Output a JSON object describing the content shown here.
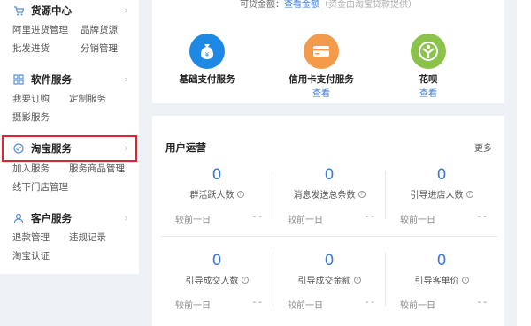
{
  "sidebar": {
    "sections": [
      {
        "title": "货源中心",
        "icon": "cart-icon",
        "links": [
          [
            "阿里进货管理",
            "品牌货源"
          ],
          [
            "批发进货",
            "分销管理"
          ]
        ]
      },
      {
        "title": "软件服务",
        "icon": "grid-icon",
        "links": [
          [
            "我要订购",
            "定制服务"
          ],
          [
            "摄影服务"
          ]
        ]
      },
      {
        "title": "淘宝服务",
        "icon": "taobao-icon",
        "links": [
          [
            "加入服务",
            "服务商品管理"
          ],
          [
            "线下门店管理"
          ]
        ]
      },
      {
        "title": "客户服务",
        "icon": "user-icon",
        "links": [
          [
            "退款管理",
            "违规记录"
          ],
          [
            "淘宝认证"
          ]
        ]
      }
    ]
  },
  "credit": {
    "prefix": "可贷金额：",
    "link": "查看金额",
    "note": "（资金由淘宝贷款提供）"
  },
  "services": [
    {
      "name": "基础支付服务",
      "view": "",
      "color": "#1e88e5",
      "icon": "money-bag-icon"
    },
    {
      "name": "信用卡支付服务",
      "view": "查看",
      "color": "#f39a4b",
      "icon": "credit-card-icon"
    },
    {
      "name": "花呗",
      "view": "查看",
      "color": "#8bc34a",
      "icon": "huabei-icon"
    }
  ],
  "ops": {
    "title": "用户运营",
    "more": "更多",
    "compare_label": "较前一日",
    "compare_value": "- -",
    "metrics": [
      {
        "value": "0",
        "label": "群活跃人数"
      },
      {
        "value": "0",
        "label": "消息发送总条数"
      },
      {
        "value": "0",
        "label": "引导进店人数"
      },
      {
        "value": "0",
        "label": "引导成交人数"
      },
      {
        "value": "0",
        "label": "引导成交金额"
      },
      {
        "value": "0",
        "label": "引导客单价"
      }
    ]
  }
}
